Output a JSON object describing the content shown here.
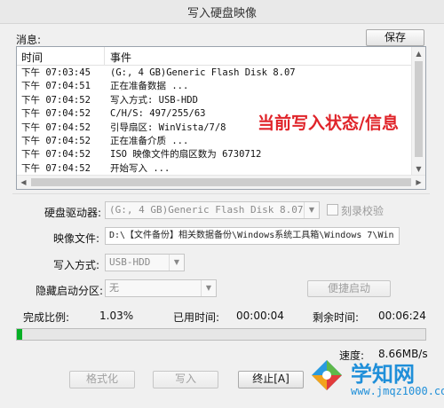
{
  "window": {
    "title": "写入硬盘映像"
  },
  "messages": {
    "label": "消息:",
    "save_label": "保存",
    "columns": {
      "time": "时间",
      "event": "事件"
    },
    "rows": [
      {
        "time": "下午 07:03:45",
        "event": "(G:, 4 GB)Generic Flash Disk       8.07"
      },
      {
        "time": "下午 07:04:51",
        "event": "正在准备数据 ..."
      },
      {
        "time": "下午 07:04:52",
        "event": "写入方式: USB-HDD"
      },
      {
        "time": "下午 07:04:52",
        "event": "C/H/S: 497/255/63"
      },
      {
        "time": "下午 07:04:52",
        "event": "引导扇区: WinVista/7/8"
      },
      {
        "time": "下午 07:04:52",
        "event": "正在准备介质 ..."
      },
      {
        "time": "下午 07:04:52",
        "event": "ISO 映像文件的扇区数为 6730712"
      },
      {
        "time": "下午 07:04:52",
        "event": "开始写入 ..."
      }
    ],
    "overlay_text": "当前写入状态/信息"
  },
  "form": {
    "drive_label": "硬盘驱动器:",
    "drive_value": "(G:, 4 GB)Generic Flash Disk      8.07",
    "verify_label": "刻录校验",
    "image_label": "映像文件:",
    "image_value": "D:\\【文件备份】相关数据备份\\Windows系统工具箱\\Windows 7\\Win",
    "write_method_label": "写入方式:",
    "write_method_value": "USB-HDD",
    "hidden_partition_label": "隐藏启动分区:",
    "hidden_partition_value": "无",
    "convenient_boot_label": "便捷启动"
  },
  "status": {
    "percent_label": "完成比例:",
    "percent_value": "1.03%",
    "elapsed_label": "已用时间:",
    "elapsed_value": "00:00:04",
    "remaining_label": "剩余时间:",
    "remaining_value": "00:06:24",
    "progress_fraction": 0.0103,
    "speed_label": "速度:",
    "speed_value": "8.66MB/s"
  },
  "buttons": {
    "format_label": "格式化",
    "write_label": "写入",
    "terminate_label": "终止[A]"
  },
  "watermark": {
    "name": "学知网",
    "url": "www.jmqz1000.com"
  },
  "colors": {
    "overlay": "#e0242a",
    "progress": "#06b025",
    "watermark": "#1f8fd9"
  }
}
